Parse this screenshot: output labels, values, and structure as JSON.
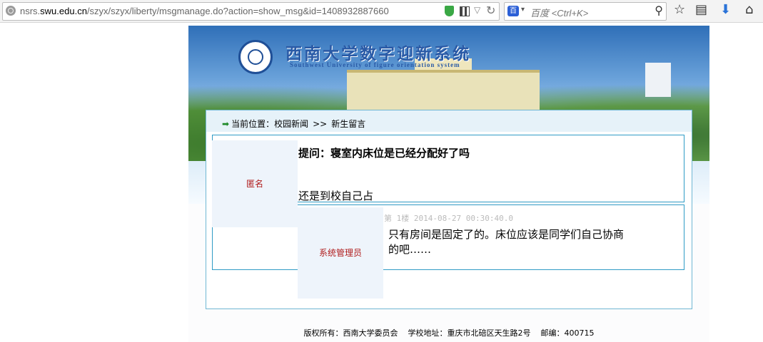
{
  "browser": {
    "url_prefix": "nsrs.",
    "url_domain": "swu.edu.cn",
    "url_path": "/szyx/szyx/liberty/msgmanage.do?action=show_msg&id=1408932887660",
    "search_engine_label": "百",
    "search_placeholder": "百度 <Ctrl+K>",
    "icons": [
      "globe-icon",
      "shield-icon",
      "qr-code-icon",
      "dropdown-icon",
      "reload-icon",
      "search-icon",
      "star-icon",
      "reading-list-icon",
      "download-icon",
      "home-icon"
    ]
  },
  "site": {
    "title": "西南大学数字迎新系统",
    "subtitle": "Southwest University of figure orientation system"
  },
  "breadcrumb": {
    "label": "当前位置：",
    "item1": "校园新闻",
    "separator": ">>",
    "item2": "新生留言"
  },
  "question": {
    "author": "匿名",
    "title": "提问：寝室内床位是已经分配好了吗",
    "body": "还是到校自己占"
  },
  "reply": {
    "author": "系统管理员",
    "meta": "第 1楼 2014-08-27 00:30:40.0",
    "body": "只有房间是固定了的。床位应该是同学们自己协商的吧……"
  },
  "footer": {
    "text": "版权所有：西南大学委员会    学校地址：重庆市北碚区天生路2号    邮编：400715"
  }
}
